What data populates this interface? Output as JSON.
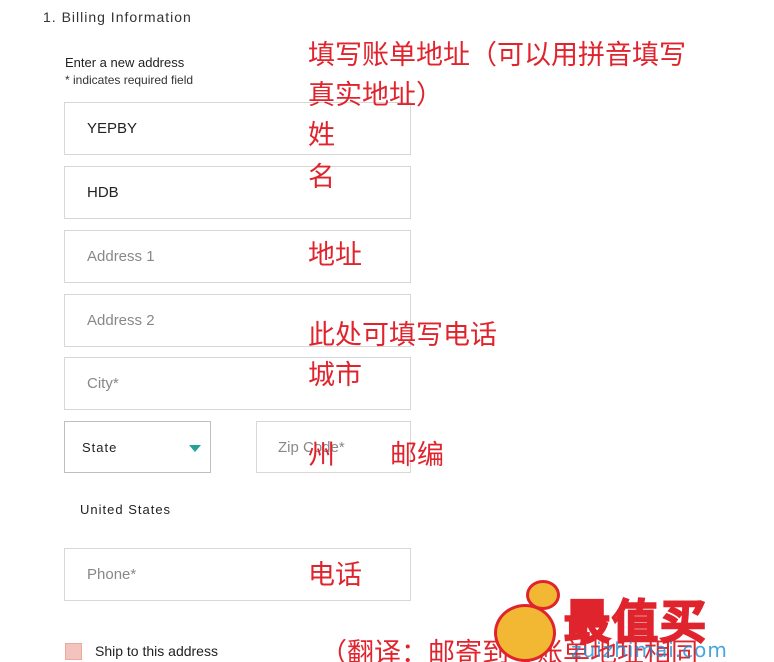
{
  "form": {
    "section_title": "1. Billing Information",
    "subtitle": "Enter a new address",
    "required_note": "* indicates required field",
    "first_name": {
      "value": "YEPBY",
      "placeholder": ""
    },
    "last_name": {
      "value": "HDB",
      "placeholder": ""
    },
    "address1": {
      "value": "",
      "placeholder": "Address 1"
    },
    "address2": {
      "value": "",
      "placeholder": "Address 2"
    },
    "city": {
      "value": "",
      "placeholder": "City*"
    },
    "state": {
      "selected": "State"
    },
    "zip": {
      "value": "",
      "placeholder": "Zip Code*"
    },
    "country": "United States",
    "phone": {
      "value": "",
      "placeholder": "Phone*"
    },
    "ship_label": "Ship to this address"
  },
  "annotations": {
    "billing_line1": "填写账单地址（可以用拼音填写",
    "billing_line2": "真实地址）",
    "name1": "姓",
    "name2": "名",
    "address": "地址",
    "phone_here": "此处可填写电话",
    "city": "城市",
    "state": "州",
    "zip": "邮编",
    "phone": "电话",
    "bottom": "（翻译：邮寄到写账单地址相同"
  },
  "logo": {
    "brand": "最值买",
    "url": "zuizhimai.com"
  },
  "colors": {
    "annotation": "#e0242d",
    "accent": "#1fa39a",
    "checkbox": "#f3c4bd"
  }
}
